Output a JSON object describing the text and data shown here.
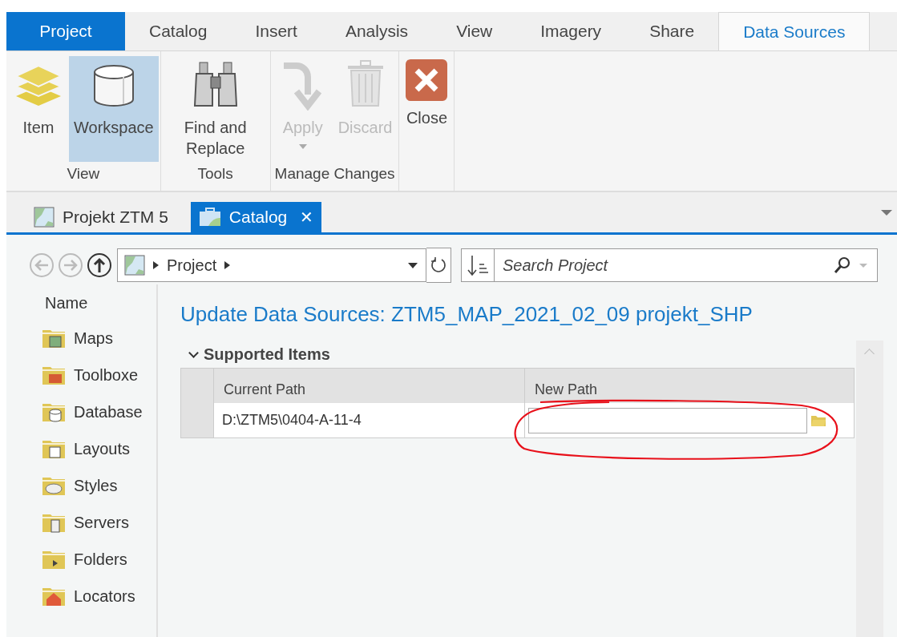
{
  "ribbon_tabs": [
    {
      "label": "Project",
      "kind": "backstage",
      "selected": false
    },
    {
      "label": "Catalog",
      "kind": "tab",
      "selected": false
    },
    {
      "label": "Insert",
      "kind": "tab",
      "selected": false
    },
    {
      "label": "Analysis",
      "kind": "tab",
      "selected": false
    },
    {
      "label": "View",
      "kind": "tab",
      "selected": false
    },
    {
      "label": "Imagery",
      "kind": "tab",
      "selected": false
    },
    {
      "label": "Share",
      "kind": "tab",
      "selected": false
    },
    {
      "label": "Data Sources",
      "kind": "tab",
      "selected": true
    }
  ],
  "ribbon_groups": [
    {
      "label": "View",
      "buttons": [
        {
          "label": "Item",
          "kind": "layers",
          "selected": false,
          "disabled": false,
          "dropdown": false
        },
        {
          "label": "Workspace",
          "kind": "cylinder",
          "selected": true,
          "disabled": false,
          "dropdown": false
        }
      ]
    },
    {
      "label": "Tools",
      "buttons": [
        {
          "label": "Find and Replace",
          "kind": "binoculars",
          "selected": false,
          "disabled": false,
          "dropdown": false
        }
      ]
    },
    {
      "label": "Manage Changes",
      "buttons": [
        {
          "label": "Apply",
          "kind": "arrow",
          "selected": false,
          "disabled": true,
          "dropdown": true
        },
        {
          "label": "Discard",
          "kind": "trash",
          "selected": false,
          "disabled": true,
          "dropdown": false
        }
      ]
    },
    {
      "buttons": [
        {
          "label": "Close",
          "kind": "close",
          "selected": false,
          "disabled": false,
          "dropdown": false
        }
      ]
    }
  ],
  "pane_tabs": [
    {
      "label": "Projekt ZTM 5",
      "kind": "map",
      "selected": false,
      "closable": false
    },
    {
      "label": "Catalog",
      "kind": "catalog",
      "selected": true,
      "closable": true
    }
  ],
  "close_glyph": "✕",
  "navigation": {
    "back_disabled": true,
    "forward_disabled": true,
    "up_disabled": false,
    "breadcrumb": "Project",
    "search": {
      "placeholder": "Search Project"
    }
  },
  "sidebar": {
    "header": "Name",
    "items": [
      {
        "label": "Maps",
        "kind": "maps"
      },
      {
        "label": "Toolboxe",
        "kind": "toolboxes"
      },
      {
        "label": "Database",
        "kind": "databases"
      },
      {
        "label": "Layouts",
        "kind": "layouts"
      },
      {
        "label": "Styles",
        "kind": "styles"
      },
      {
        "label": "Servers",
        "kind": "servers"
      },
      {
        "label": "Folders",
        "kind": "folders"
      },
      {
        "label": "Locators",
        "kind": "locators"
      }
    ]
  },
  "content": {
    "title": "Update Data Sources: ZTM5_MAP_2021_02_09 projekt_SHP",
    "section": {
      "label": "Supported Items",
      "expanded": true
    },
    "table": {
      "columns": [
        "Current Path",
        "New Path"
      ],
      "rows": [
        {
          "current_path": "D:\\ZTM5\\0404-A-11-4"
        }
      ]
    }
  }
}
